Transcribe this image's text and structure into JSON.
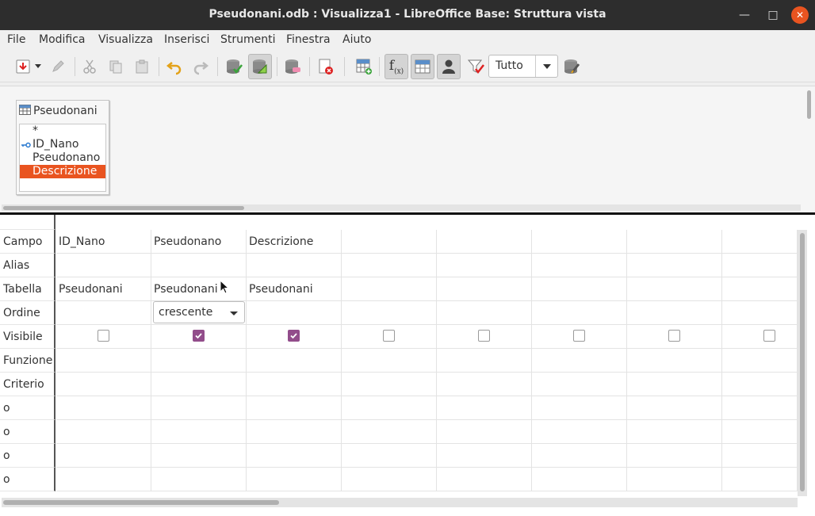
{
  "window": {
    "title": "Pseudonani.odb : Visualizza1 - LibreOffice Base: Struttura vista"
  },
  "menubar": {
    "items": [
      "File",
      "Modifica",
      "Visualizza",
      "Inserisci",
      "Strumenti",
      "Finestra",
      "Aiuto"
    ]
  },
  "toolbar": {
    "limit_select_value": "Tutto",
    "icons": [
      "save-icon",
      "edit-icon",
      "cut-icon",
      "copy-icon",
      "paste-icon",
      "undo-icon",
      "redo-icon",
      "run-query-icon",
      "design-view-icon",
      "clear-query-icon",
      "delete-icon",
      "add-table-icon",
      "functions-icon",
      "table-names-icon",
      "alias-icon",
      "distinct-icon",
      "sql-icon"
    ]
  },
  "table_pane": {
    "table_name": "Pseudonani",
    "fields": [
      {
        "label": "*",
        "key": false,
        "selected": false
      },
      {
        "label": "ID_Nano",
        "key": true,
        "selected": false
      },
      {
        "label": "Pseudonano",
        "key": false,
        "selected": false
      },
      {
        "label": "Descrizione",
        "key": false,
        "selected": true
      }
    ]
  },
  "grid": {
    "row_labels": [
      "Campo",
      "Alias",
      "Tabella",
      "Ordine",
      "Visibile",
      "Funzione",
      "Criterio",
      "o",
      "o",
      "o",
      "o"
    ],
    "columns": [
      {
        "campo": "ID_Nano",
        "alias": "",
        "tabella": "Pseudonani",
        "ordine": "",
        "visibile": false
      },
      {
        "campo": "Pseudonano",
        "alias": "",
        "tabella": "Pseudonani",
        "ordine": "crescente",
        "visibile": true
      },
      {
        "campo": "Descrizione",
        "alias": "",
        "tabella": "Pseudonani",
        "ordine": "",
        "visibile": true
      },
      {
        "campo": "",
        "alias": "",
        "tabella": "",
        "ordine": "",
        "visibile": false
      },
      {
        "campo": "",
        "alias": "",
        "tabella": "",
        "ordine": "",
        "visibile": false
      },
      {
        "campo": "",
        "alias": "",
        "tabella": "",
        "ordine": "",
        "visibile": false
      },
      {
        "campo": "",
        "alias": "",
        "tabella": "",
        "ordine": "",
        "visibile": false
      },
      {
        "campo": "",
        "alias": "",
        "tabella": "",
        "ordine": "",
        "visibile": false
      }
    ]
  },
  "colors": {
    "accent": "#e95420",
    "checkbox_on": "#924d8b",
    "titlebar": "#2d2d2d"
  }
}
